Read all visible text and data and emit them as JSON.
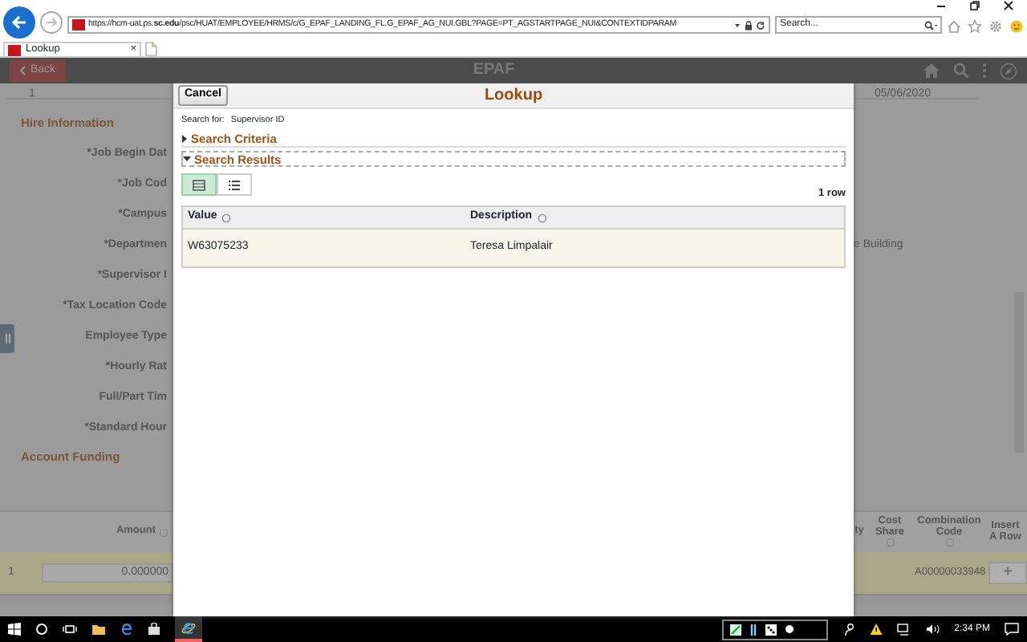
{
  "browser": {
    "url": "https://hcm-uat.ps.**sc.edu**/psc/HUAT/EMPLOYEE/HRMS/c/G_EPAF_LANDING_FL.G_EPAF_AG_NUI.GBL?PAGE=PT_AGSTARTPAGE_NUI&CONTEXTIDPARAM",
    "search_placeholder": "Search...",
    "tab": "Lookup",
    "tab_close": "×"
  },
  "app_header": {
    "back": "Back",
    "title": "EPAF"
  },
  "record_row": {
    "number": "1",
    "date": "05/06/2020"
  },
  "hire_section": "Hire Information",
  "hire_fields": [
    {
      "label": "*Job Begin Dat"
    },
    {
      "label": "*Job Cod"
    },
    {
      "label": "*Campus"
    },
    {
      "label": "*Departmen",
      "value": "e Building"
    },
    {
      "label": "*Supervisor I"
    },
    {
      "label": "*Tax Location Code"
    },
    {
      "label": "Employee Type"
    },
    {
      "label": "*Hourly Rat"
    },
    {
      "label": "Full/Part Tim"
    },
    {
      "label": "*Standard Hour"
    }
  ],
  "funding_section": "Account Funding",
  "funding_table": {
    "columns": [
      {
        "label": "Amount",
        "sortable": true
      },
      {
        "label": "ty",
        "sortable": false
      },
      {
        "label": "Cost Share",
        "sortable": true
      },
      {
        "label": "Combination Code",
        "sortable": true
      },
      {
        "label": "Insert A Row",
        "sortable": false
      }
    ],
    "rows": [
      {
        "number": "1",
        "amount": "0.000000",
        "combination_code": "A00000033948",
        "insert": "+"
      }
    ]
  },
  "modal": {
    "cancel": "Cancel",
    "title": "Lookup",
    "search_for_label": "Search for:",
    "search_for_value": "Supervisor ID",
    "sections": [
      {
        "label": "Search Criteria",
        "expanded": false
      },
      {
        "label": "Search Results",
        "expanded": true
      }
    ],
    "view_buttons": [
      {
        "kind": "grid",
        "selected": true
      },
      {
        "kind": "list",
        "selected": false
      }
    ],
    "row_count": "1 row",
    "columns": [
      "Value",
      "Description"
    ],
    "rows": [
      [
        "W63075233",
        "Teresa Limpalair"
      ]
    ]
  },
  "taskbar": {
    "time": "2:34 PM"
  }
}
